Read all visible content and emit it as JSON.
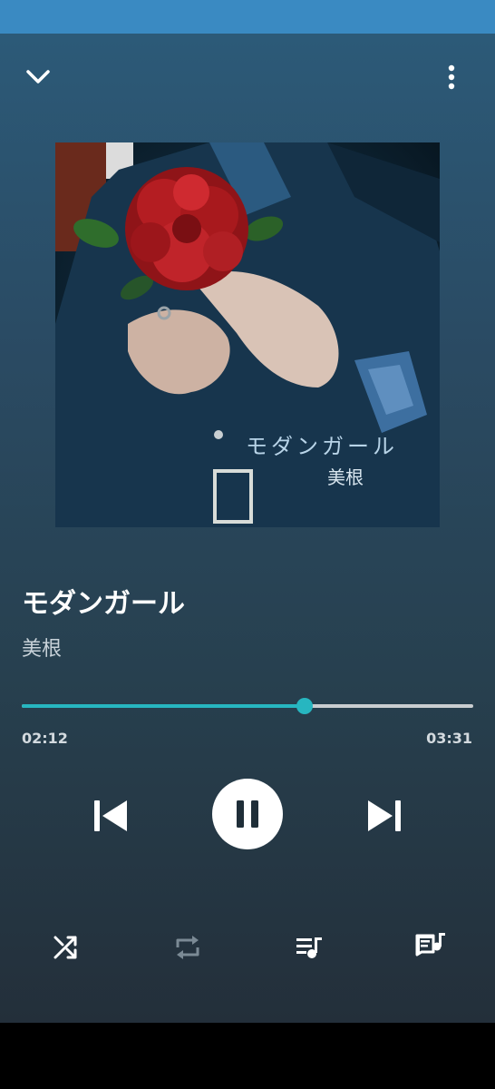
{
  "player": {
    "album_art": {
      "title_text": "モダンガール",
      "artist_text": "美根"
    },
    "track": {
      "title": "モダンガール",
      "artist": "美根"
    },
    "progress": {
      "elapsed": "02:12",
      "total": "03:31",
      "fraction": 0.626
    },
    "icons": {
      "collapse": "chevron-down-icon",
      "more": "more-vert-icon",
      "previous": "skip-previous-icon",
      "play_pause": "pause-icon",
      "next": "skip-next-icon",
      "shuffle": "shuffle-icon",
      "repeat": "repeat-icon",
      "queue": "queue-music-icon",
      "lyrics": "lyrics-icon"
    },
    "colors": {
      "status_bar": "#3a8ac2",
      "accent": "#27b6c0",
      "background_top": "#2c5a78",
      "background_bottom": "#232f3a"
    }
  }
}
